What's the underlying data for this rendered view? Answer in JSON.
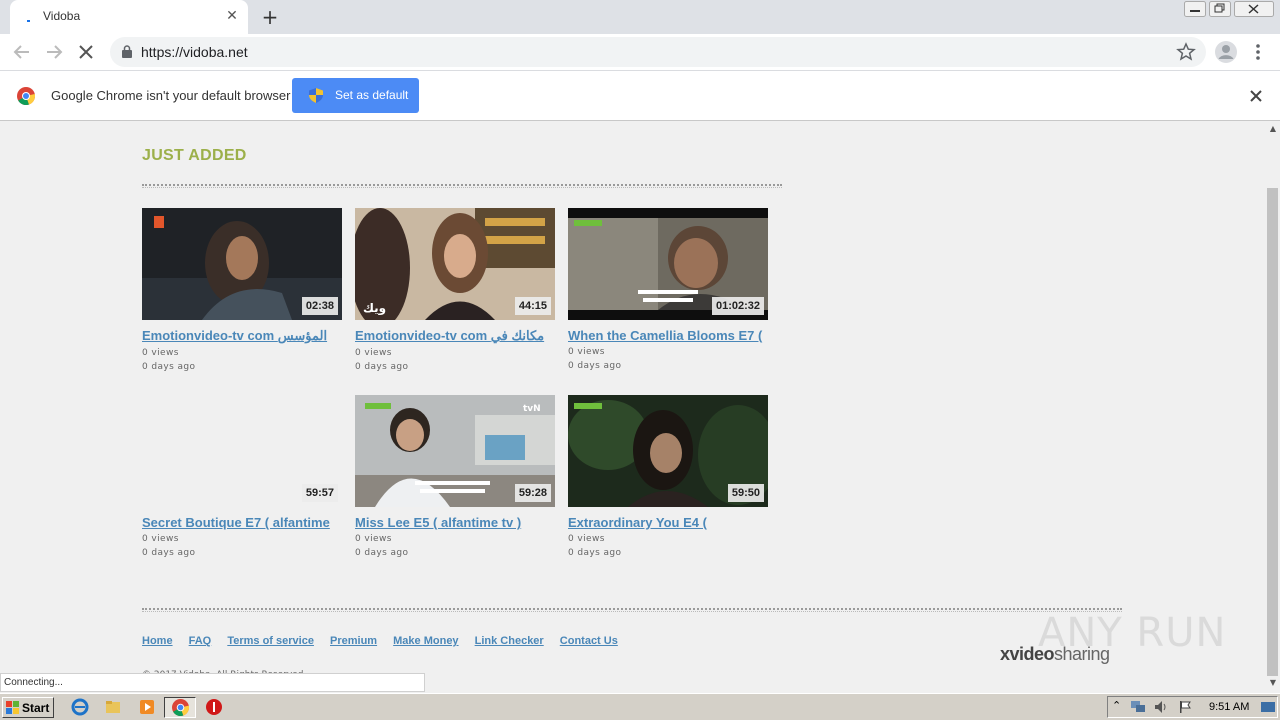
{
  "browser": {
    "tab_title": "Vidoba",
    "tab_close": "✕",
    "new_tab": "+",
    "url": "https://vidoba.net"
  },
  "infobar": {
    "message": "Google Chrome isn't your default browser",
    "button_label": "Set as default"
  },
  "page": {
    "section_title": "JUST ADDED",
    "videos": [
      {
        "title": "Emotionvideo-tv com المؤسس",
        "duration": "02:38",
        "views": "0 views",
        "age": "0 days ago",
        "thumb": "dark-warrior"
      },
      {
        "title": "Emotionvideo-tv com مكانك في",
        "duration": "44:15",
        "views": "0 views",
        "age": "0 days ago",
        "thumb": "woman-interior"
      },
      {
        "title": "When the Camellia Blooms E7 (",
        "duration": "01:02:32",
        "views": "0 views",
        "age": "0 days ago",
        "thumb": "old-man"
      },
      {
        "title": "Secret Boutique E7 ( alfantime",
        "duration": "59:57",
        "views": "0 views",
        "age": "0 days ago",
        "thumb": "blank"
      },
      {
        "title": "Miss Lee E5 ( alfantime tv )",
        "duration": "59:28",
        "views": "0 views",
        "age": "0 days ago",
        "thumb": "office"
      },
      {
        "title": "Extraordinary You E4 (",
        "duration": "59:50",
        "views": "0 views",
        "age": "0 days ago",
        "thumb": "forest-girl"
      }
    ],
    "footer_links": [
      "Home",
      "FAQ",
      "Terms of service",
      "Premium",
      "Make Money",
      "Link Checker",
      "Contact Us"
    ],
    "brand_bold": "xvideo",
    "brand_light": "sharing",
    "watermark": "ANY RUN",
    "copyright": "© 2017 Vidoba. All Rights Reserved."
  },
  "status": {
    "text": "Connecting..."
  },
  "taskbar": {
    "start_label": "Start",
    "clock": "9:51 AM"
  },
  "colors": {
    "section_title": "#9cb04a",
    "link": "#4a87b8",
    "button_blue": "#4c8bf5"
  }
}
